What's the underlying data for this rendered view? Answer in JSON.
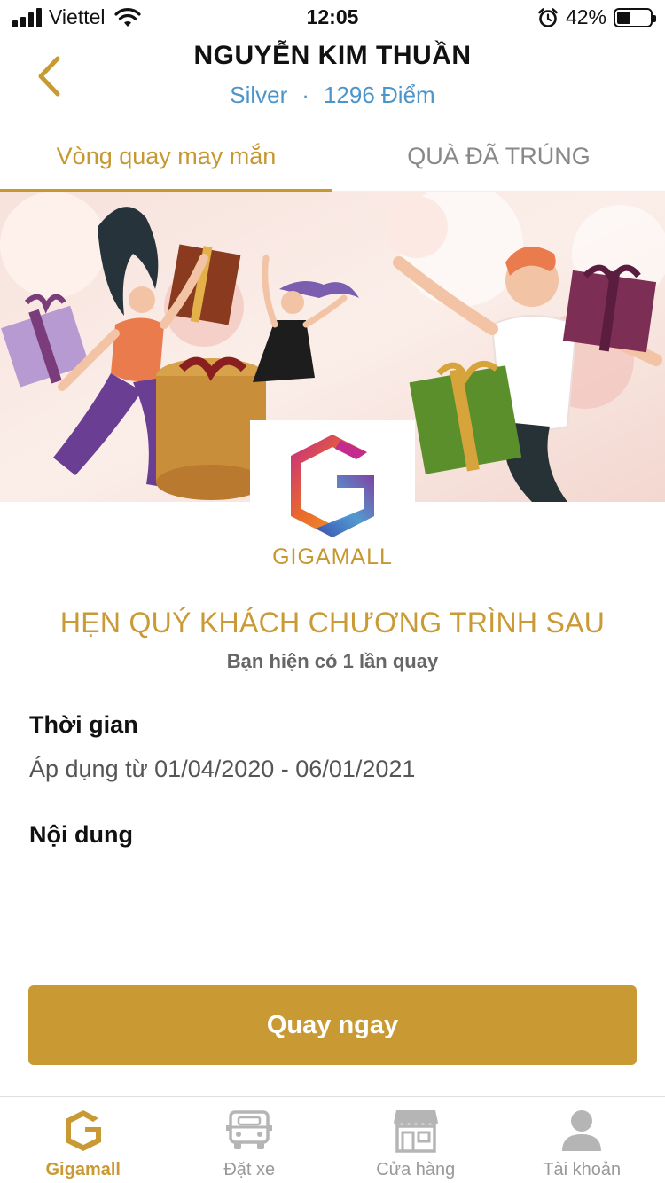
{
  "status_bar": {
    "carrier": "Viettel",
    "time": "12:05",
    "battery_percent": "42%",
    "battery_level": 0.42,
    "icons": [
      "signal-icon",
      "wifi-icon",
      "alarm-icon",
      "battery-icon"
    ]
  },
  "header": {
    "name": "NGUYỄN KIM THUẦN",
    "tier": "Silver",
    "separator": "·",
    "points": "1296 Điểm",
    "back_icon": "chevron-left-icon"
  },
  "tabs": [
    {
      "label": "Vòng quay may mắn",
      "active": true
    },
    {
      "label": "QUÀ ĐÃ TRÚNG",
      "active": false
    }
  ],
  "logo": {
    "text": "GIGAMALL"
  },
  "promo": {
    "headline": "HẸN QUÝ KHÁCH CHƯƠNG TRÌNH SAU",
    "spin_count": "Bạn hiện có 1 lần quay"
  },
  "details": {
    "time_title": "Thời gian",
    "time_text": "Áp dụng từ 01/04/2020 - 06/01/2021",
    "content_title": "Nội dung"
  },
  "cta": {
    "label": "Quay ngay"
  },
  "bottom_nav": [
    {
      "label": "Gigamall",
      "icon": "gigamall-icon",
      "active": true
    },
    {
      "label": "Đặt xe",
      "icon": "car-icon",
      "active": false
    },
    {
      "label": "Cửa hàng",
      "icon": "store-icon",
      "active": false
    },
    {
      "label": "Tài khoản",
      "icon": "account-icon",
      "active": false
    }
  ],
  "colors": {
    "accent": "#c99a34",
    "link_blue": "#4d95c9",
    "muted": "#999999"
  }
}
